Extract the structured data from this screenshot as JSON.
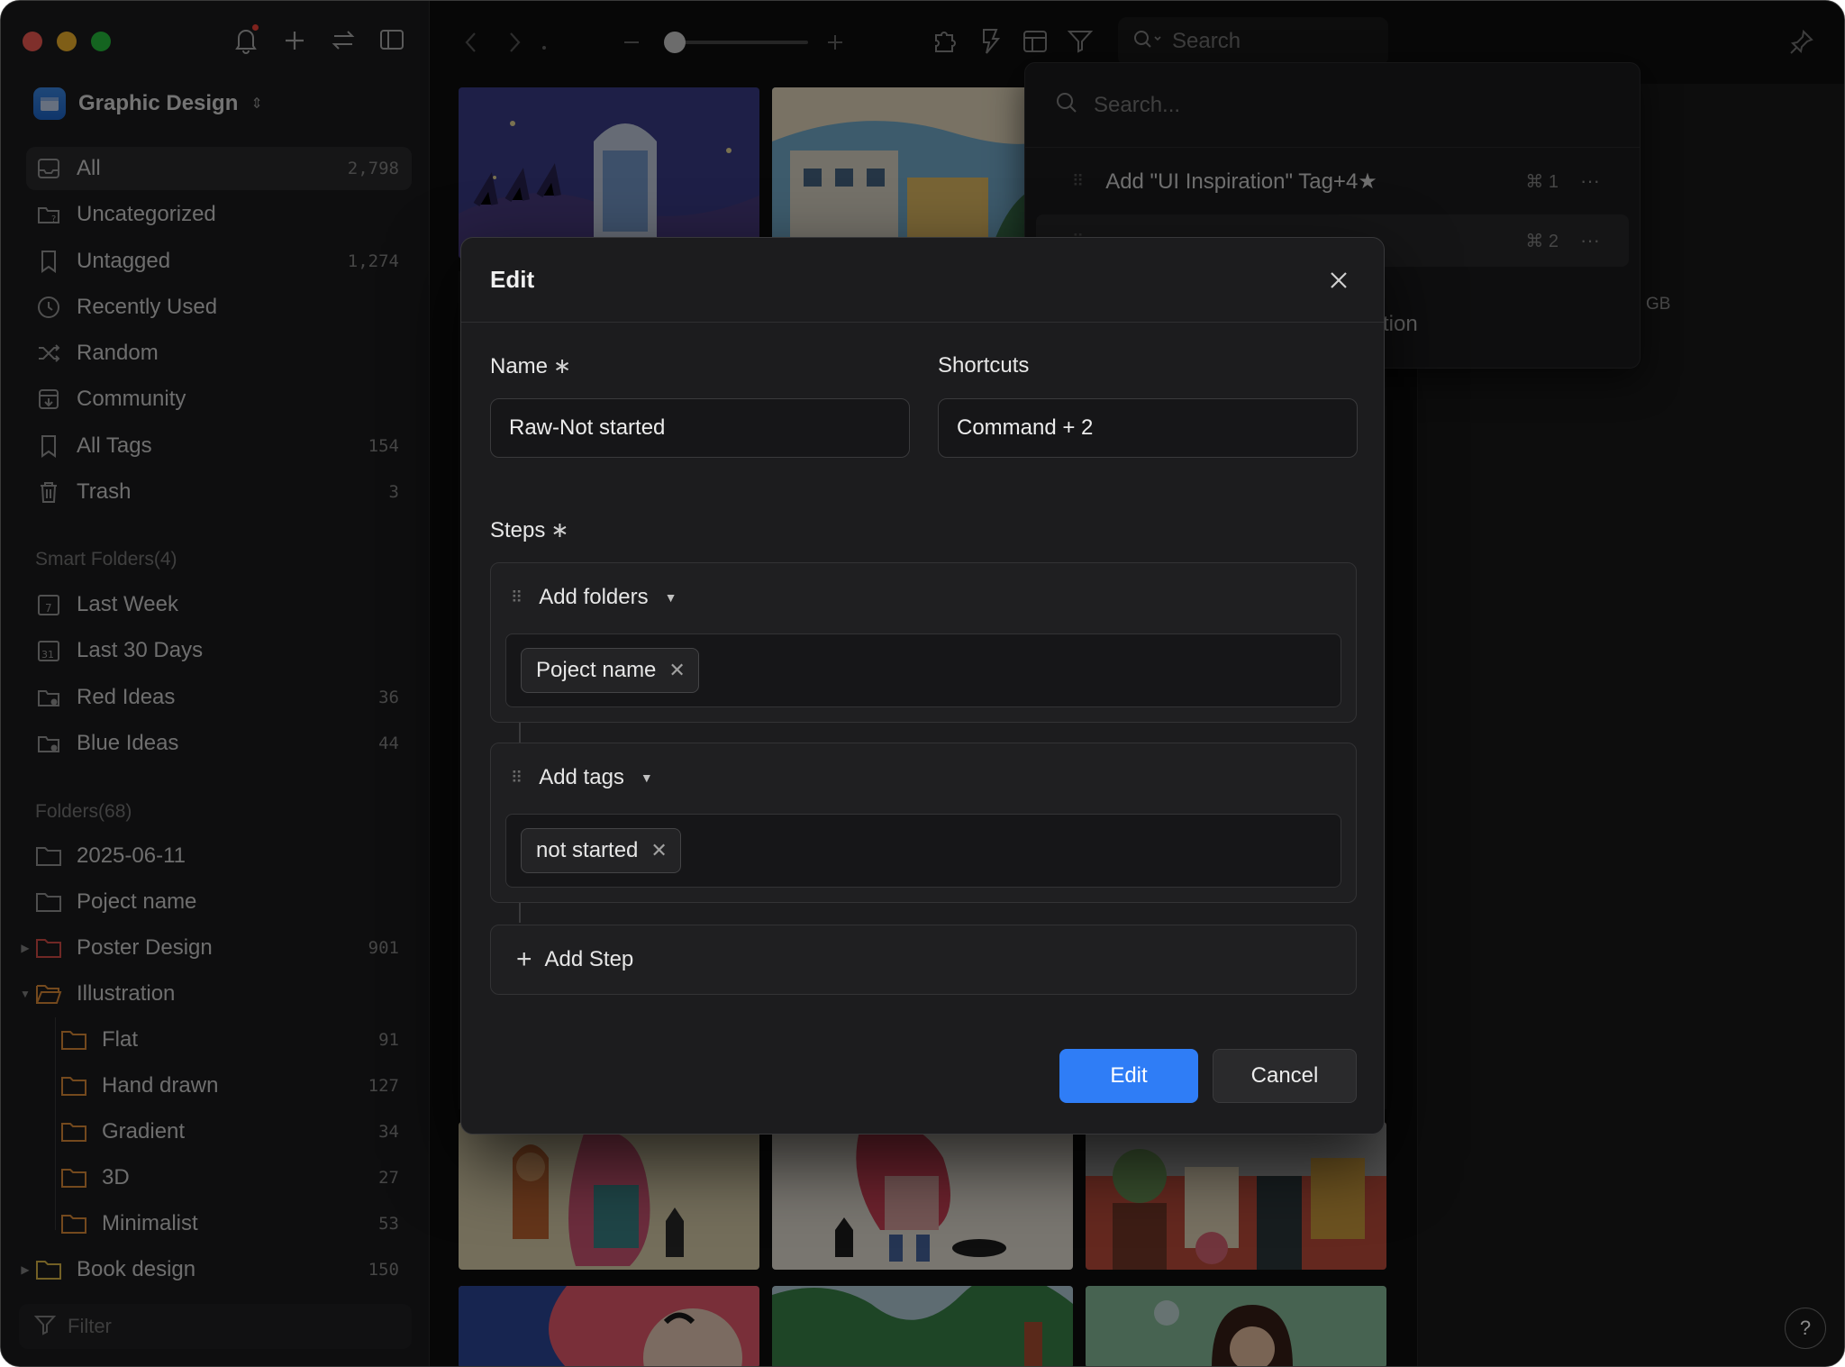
{
  "sidebar": {
    "library_name": "Graphic Design",
    "nav": [
      {
        "label": "All",
        "count": "2,798",
        "icon": "inbox-icon",
        "active": true
      },
      {
        "label": "Uncategorized",
        "count": "",
        "icon": "uncategorized-folder-icon"
      },
      {
        "label": "Untagged",
        "count": "1,274",
        "icon": "untagged-icon"
      },
      {
        "label": "Recently Used",
        "count": "",
        "icon": "clock-icon"
      },
      {
        "label": "Random",
        "count": "",
        "icon": "shuffle-icon"
      },
      {
        "label": "Community",
        "count": "",
        "icon": "community-icon"
      },
      {
        "label": "All Tags",
        "count": "154",
        "icon": "bookmark-icon"
      },
      {
        "label": "Trash",
        "count": "3",
        "icon": "trash-icon"
      }
    ],
    "smart_folders_title": "Smart Folders(4)",
    "smart_folders": [
      {
        "label": "Last Week",
        "count": "",
        "icon": "calendar-7-icon"
      },
      {
        "label": "Last 30 Days",
        "count": "",
        "icon": "calendar-31-icon"
      },
      {
        "label": "Red Ideas",
        "count": "36",
        "icon": "smart-folder-icon"
      },
      {
        "label": "Blue Ideas",
        "count": "44",
        "icon": "smart-folder-icon"
      }
    ],
    "folders_title": "Folders(68)",
    "folders": [
      {
        "label": "2025-06-11",
        "count": ""
      },
      {
        "label": "Poject name",
        "count": ""
      },
      {
        "label": "Poster Design",
        "count": "901"
      },
      {
        "label": "Illustration",
        "count": ""
      },
      {
        "label": "Flat",
        "count": "91"
      },
      {
        "label": "Hand drawn",
        "count": "127"
      },
      {
        "label": "Gradient",
        "count": "34"
      },
      {
        "label": "3D",
        "count": "27"
      },
      {
        "label": "Minimalist",
        "count": "53"
      },
      {
        "label": "Book design",
        "count": "150"
      }
    ],
    "filter_placeholder": "Filter"
  },
  "toolbar": {
    "search_placeholder": "Search"
  },
  "dropdown": {
    "search_placeholder": "Search...",
    "items": [
      {
        "label": "Add \"UI Inspiration\" Tag+4★",
        "shortcut": "⌘ 1",
        "more": "···"
      },
      {
        "label": "",
        "shortcut": "⌘ 2",
        "more": "···"
      }
    ],
    "partial_text": "tion",
    "partial_gb": "GB"
  },
  "modal": {
    "title": "Edit",
    "name_label": "Name",
    "name_value": "Raw-Not started",
    "shortcuts_label": "Shortcuts",
    "shortcuts_value": "Command + 2",
    "steps_label": "Steps",
    "required_mark": "∗",
    "steps": [
      {
        "action": "Add folders",
        "chip": "Poject name"
      },
      {
        "action": "Add tags",
        "chip": "not started"
      }
    ],
    "add_step_label": "Add Step",
    "primary_button": "Edit",
    "secondary_button": "Cancel"
  },
  "help_label": "?",
  "colors": {
    "accent": "#2f7df6",
    "folder_red": "#e0504a",
    "folder_orange": "#e8923a",
    "folder_yellow": "#e7c04a",
    "folder_gray": "#9c9c9c"
  }
}
